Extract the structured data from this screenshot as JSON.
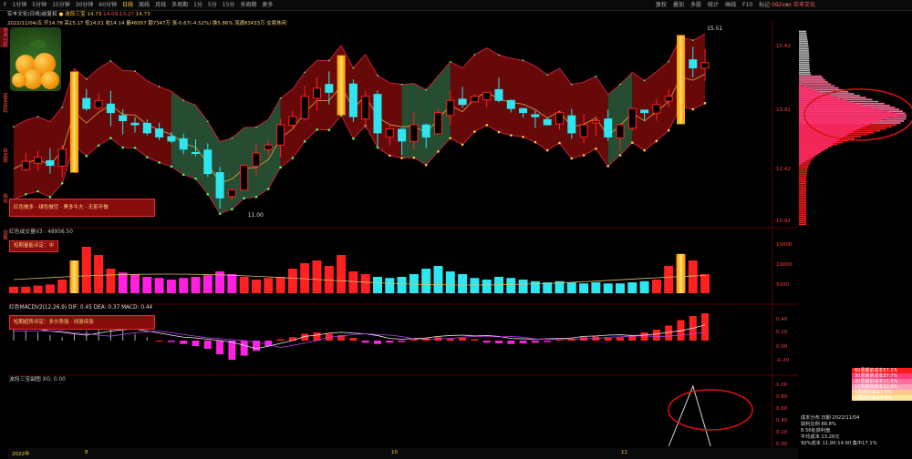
{
  "topbar": {
    "periods": [
      "F",
      "1分钟",
      "5分钟",
      "15分钟",
      "30分钟",
      "60分钟",
      "日线",
      "周线",
      "月线",
      "多周期",
      "1分",
      "5分",
      "15分",
      "多周期",
      "更多"
    ],
    "active_index": 6,
    "stock_title": "002xxx 实丰文化",
    "right_buttons": [
      "复权",
      "叠加",
      "多股",
      "统计",
      "画线",
      "F10",
      "标记",
      "-",
      "×"
    ]
  },
  "infoline": {
    "prefix": "实丰文化(日线)前复权",
    "indicator": "波段三宝",
    "values": [
      {
        "label": "",
        "value": "14.73",
        "color": "#ffcc33"
      },
      {
        "label": "",
        "value": "14.09",
        "color": "#ff5050"
      },
      {
        "label": "",
        "value": "13.27",
        "color": "#ff5050"
      },
      {
        "label": "",
        "value": "14.73",
        "color": "#ffcc33"
      }
    ]
  },
  "infoline2": "2022/11/04/五 开14.78 高15.17 低14.01 收14.14 量46057 额7347万 涨-0.67(-4.52%) 换5.86% 流通83433万 交易休闲",
  "price_axis": [
    "15.42",
    "13.92",
    "12.42",
    "10.92"
  ],
  "price_high_label": "15.51",
  "price_low_label": "11.00",
  "main_tip": "红色做多 · 绿色做空 · 黑多牛大 · 无影不做",
  "volume": {
    "title": "红色成交量V3 : 48956.50",
    "tip": "短期量能评定：中",
    "axis": [
      "15000",
      "10000",
      "5000"
    ]
  },
  "macd": {
    "title": "红色MACDV2(12,26,9)  DIF: 0.45  DEA: 0.37  MACD: 0.44",
    "tip": "短期趋势评定：多头势强 · 持股待涨",
    "axis": [
      "0.40",
      "0.20",
      "0.00",
      "-0.20"
    ]
  },
  "signal": {
    "title": "波段三宝副图 XG: 0.00",
    "axis": [
      "1.00",
      "0.80",
      "0.60",
      "0.40",
      "0.20",
      "0.00"
    ]
  },
  "dates": [
    "2022年",
    "8",
    "10",
    "11"
  ],
  "sidebar_tabs": [
    "技术分析",
    "基本资料",
    "自选股",
    "画线",
    "设置"
  ],
  "chips": {
    "price_ticks": [
      "15.42",
      "13.92",
      "12.42",
      "10.92"
    ],
    "legend": [
      {
        "text": "60周期前成本57.1%",
        "color": "#ff1a1a"
      },
      {
        "text": "30周期前成本37.7%",
        "color": "#ff3b7a"
      },
      {
        "text": "20周期前成本17.5%",
        "color": "#ff6f9a"
      },
      {
        "text": "10周期前成本11.5%",
        "color": "#ffa0b8"
      },
      {
        "text": "5周期前成本3.5%",
        "color": "#ffc98a"
      },
      {
        "text": "1周期前成本0.9%",
        "color": "#ffe6a0"
      }
    ],
    "info": [
      {
        "label": "成本分布 日期",
        "value": "2022/11/04"
      },
      {
        "label": "获利比例",
        "value": "88.8%"
      },
      {
        "label": "8.56处获利盘",
        "value": ""
      },
      {
        "label": "平均成本",
        "value": "13.26元"
      },
      {
        "label": "90%成本",
        "value": "11.90-14.90 集中17.1%"
      }
    ]
  },
  "colors": {
    "up": "#ff2020",
    "down": "#2ee6f0",
    "band_red": "#7a0a0a",
    "band_green": "#2d5a3a",
    "gold": "#ffaa00"
  }
}
